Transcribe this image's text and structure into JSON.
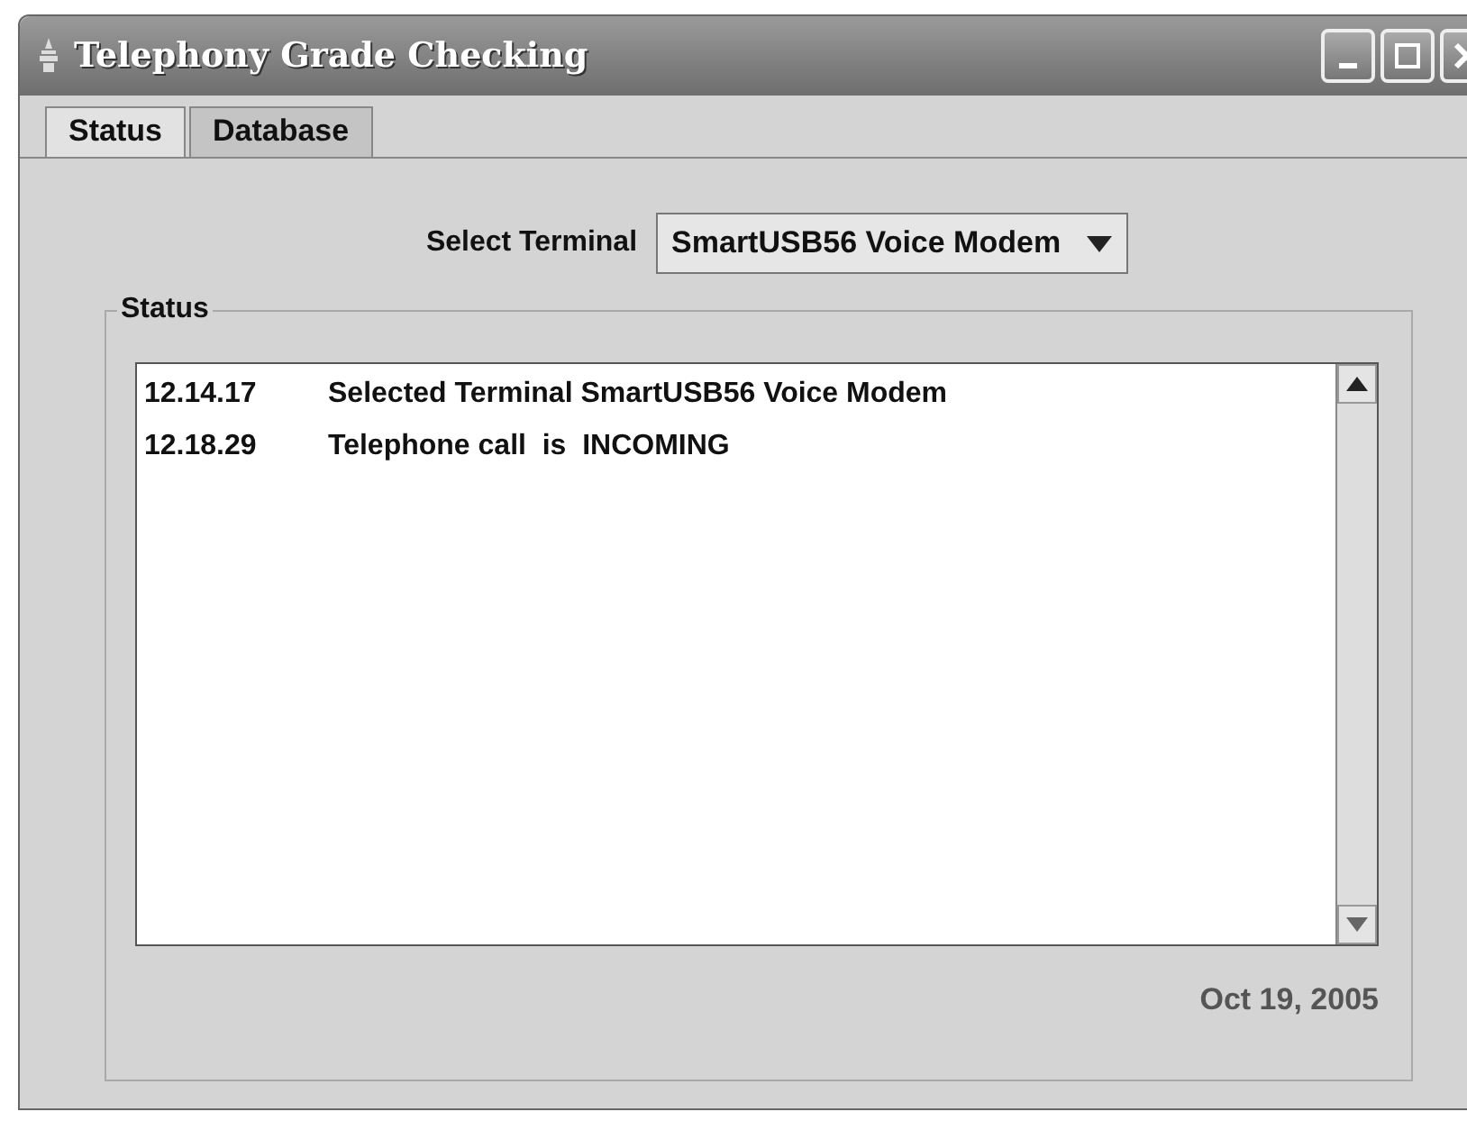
{
  "window": {
    "title": "Telephony Grade Checking"
  },
  "tabs": [
    {
      "label": "Status",
      "selected": true
    },
    {
      "label": "Database",
      "selected": false
    }
  ],
  "terminal": {
    "label": "Select Terminal",
    "value": "SmartUSB56 Voice Modem"
  },
  "status_group": {
    "title": "Status"
  },
  "log": [
    {
      "time": "12.14.17",
      "message": "Selected Terminal SmartUSB56 Voice Modem"
    },
    {
      "time": "12.18.29",
      "message": "Telephone call  is  INCOMING"
    }
  ],
  "date": "Oct 19, 2005"
}
